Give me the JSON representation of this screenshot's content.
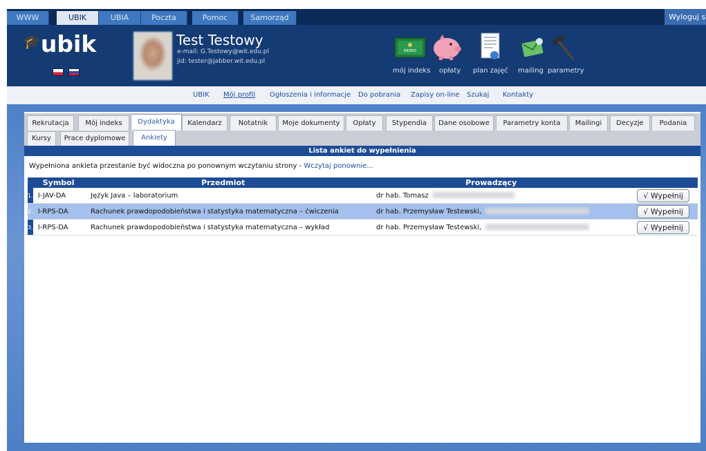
{
  "topbar": {
    "tabs": [
      "WWW",
      "UBIK",
      "UBIA",
      "Poczta",
      "Pomoc",
      "Samorząd"
    ],
    "logout": "Wyloguj s"
  },
  "brand": {
    "logo": "ubik"
  },
  "user": {
    "name": "Test Testowy",
    "email": "e-mail: G.Testowy@wit.edu.pl",
    "jid": "jid: tester@jabber.wit.edu.pl"
  },
  "quick_links": [
    "mój indeks",
    "opłaty",
    "plan zajęć",
    "mailing",
    "parametry"
  ],
  "index_card_text": "INDEKS",
  "nav": [
    "UBIK",
    "Mój profil",
    "Ogłoszenia i informacje",
    "Do pobrania",
    "Zapisy on-line",
    "Szukaj",
    "Kontakty"
  ],
  "tabs_row1": [
    "Rekrutacja",
    "Mój indeks",
    "Dydaktyka",
    "Kalendarz",
    "Notatnik",
    "Moje dokumenty",
    "Opłaty",
    "Stypendia",
    "Dane osobowe",
    "Parametry konta",
    "Mailingi",
    "Decyzje",
    "Podania"
  ],
  "tabs_row2": [
    "Kursy",
    "Prace dyplomowe",
    "Ankiety"
  ],
  "list_title": "Lista ankiet do wypełnienia",
  "info": {
    "text": "Wypełniona ankieta przestanie być widoczna po ponownym wczytaniu strony - ",
    "reload": "Wczytaj ponownie..."
  },
  "table": {
    "headers": {
      "symbol": "Symbol",
      "subject": "Przedmiot",
      "teacher": "Prowadzący"
    },
    "rows": [
      {
        "num": "1.",
        "symbol": "I-JAV-DA",
        "subject": "Język Java – laboratorium",
        "teacher": "dr hab. Tomasz",
        "button": "√ Wypełnij"
      },
      {
        "num": "2.",
        "symbol": "I-RPS-DA",
        "subject": "Rachunek prawdopodobieństwa i statystyka matematyczna – ćwiczenia",
        "teacher": "dr hab. Przemysław Testewski,",
        "button": "√ Wypełnij"
      },
      {
        "num": "3.",
        "symbol": "I-RPS-DA",
        "subject": "Rachunek prawdopodobieństwa i statystyka matematyczna – wykład",
        "teacher": "dr hab. Przemysław Testewski,",
        "button": "√ Wypełnij"
      }
    ]
  },
  "colors": {
    "header": "#143b73",
    "accent": "#1d4c96",
    "selected_row": "#a5c0ec",
    "link": "#1a4ea3"
  }
}
